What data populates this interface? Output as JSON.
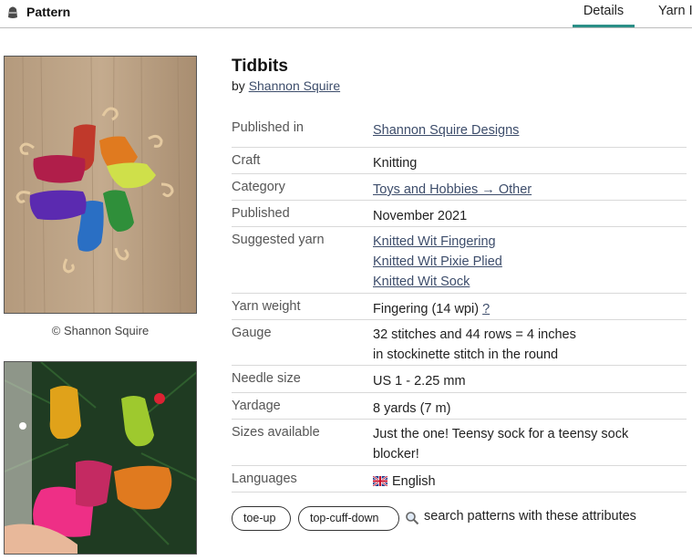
{
  "header": {
    "section_label": "Pattern",
    "tabs": [
      {
        "label": "Details",
        "active": true
      },
      {
        "label": "Yarn I",
        "active": false
      }
    ]
  },
  "photos": {
    "credit": "© Shannon Squire"
  },
  "pattern": {
    "title": "Tidbits",
    "by_prefix": "by",
    "designer": "Shannon Squire",
    "details": [
      {
        "label": "Published in",
        "values": [
          "Shannon Squire Designs"
        ],
        "link": true
      },
      {
        "label": "Craft",
        "values": [
          "Knitting"
        ],
        "link": false
      },
      {
        "label": "Category",
        "values": [
          "Toys and Hobbies → Other"
        ],
        "link": true
      },
      {
        "label": "Published",
        "values": [
          "November 2021"
        ],
        "link": false
      },
      {
        "label": "Suggested yarn",
        "values": [
          "Knitted Wit Fingering",
          "Knitted Wit Pixie Plied",
          "Knitted Wit Sock"
        ],
        "link": true
      },
      {
        "label": "Yarn weight",
        "values": [
          "Fingering (14 wpi)"
        ],
        "link": false,
        "help": "?"
      },
      {
        "label": "Gauge",
        "values": [
          "32 stitches and 44 rows = 4 inches",
          "in stockinette stitch in the round"
        ],
        "link": false
      },
      {
        "label": "Needle size",
        "values": [
          "US 1 - 2.25 mm"
        ],
        "link": false
      },
      {
        "label": "Yardage",
        "values": [
          "8 yards (7 m)"
        ],
        "link": false
      },
      {
        "label": "Sizes available",
        "values": [
          "Just the one! Teensy sock for a teensy sock",
          "blocker!"
        ],
        "link": false
      },
      {
        "label": "Languages",
        "values": [
          "English"
        ],
        "link": false,
        "flag": "uk-flag-icon"
      }
    ]
  },
  "attributes": {
    "tags": [
      "toe-up",
      "top-cuff-down"
    ],
    "search_text": "search patterns with these attributes"
  },
  "colors": {
    "accent": "#2a8f87",
    "link": "#3d4d6b",
    "divider": "#d9d9d9"
  }
}
